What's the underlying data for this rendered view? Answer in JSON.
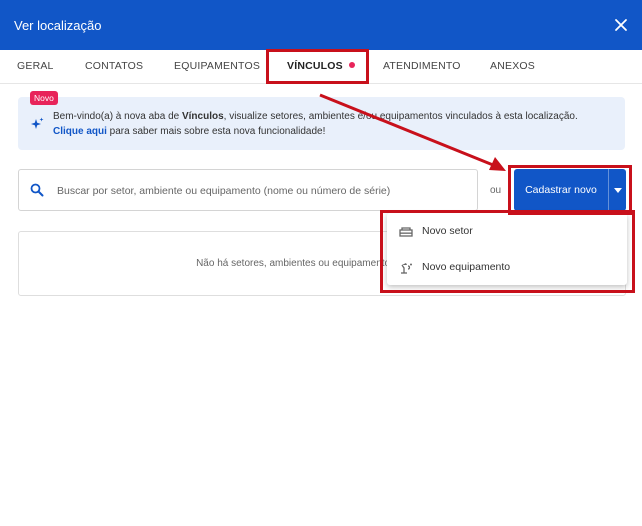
{
  "dialog": {
    "title": "Ver localização"
  },
  "tabs": [
    {
      "label": "GERAL"
    },
    {
      "label": "CONTATOS"
    },
    {
      "label": "EQUIPAMENTOS"
    },
    {
      "label": "VÍNCULOS",
      "active": true
    },
    {
      "label": "ATENDIMENTO"
    },
    {
      "label": "ANEXOS"
    }
  ],
  "banner": {
    "badge": "Novo",
    "text_before": "Bem-vindo(a) à nova aba de ",
    "text_bold": "Vínculos",
    "text_after": ", visualize setores, ambientes e/ou equipamentos vinculados à esta localização.",
    "link": "Clique aqui",
    "text_end": " para saber mais sobre esta nova funcionalidade!"
  },
  "search": {
    "placeholder": "Buscar por setor, ambiente ou equipamento (nome ou número de série)",
    "value": ""
  },
  "or_label": "ou",
  "create_button": {
    "label": "Cadastrar novo"
  },
  "empty_state": {
    "message": "Não há setores, ambientes ou equipamentos associados"
  },
  "dropdown": {
    "items": [
      {
        "label": "Novo setor",
        "icon": "sector-icon"
      },
      {
        "label": "Novo equipamento",
        "icon": "equipment-icon"
      }
    ]
  },
  "colors": {
    "primary": "#1156c7",
    "accent": "#e8245a",
    "highlight": "#c8101b",
    "banner_bg": "#e9f0fb"
  }
}
